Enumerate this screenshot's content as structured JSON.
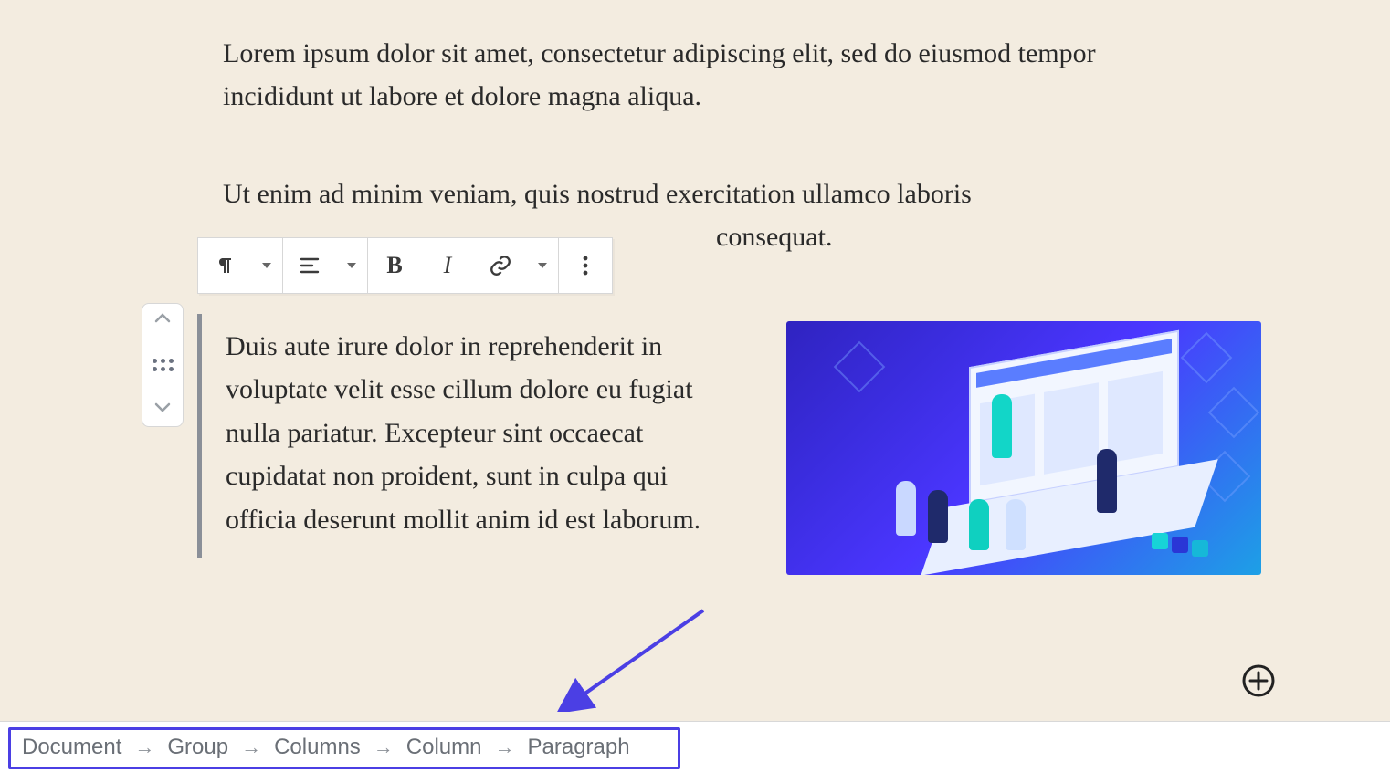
{
  "content": {
    "para1": "Lorem ipsum dolor sit amet, consectetur adipiscing elit, sed do eiusmod tempor incididunt ut labore et dolore magna aliqua.",
    "para2_line1": "Ut enim ad minim veniam, quis nostrud exercitation ullamco laboris",
    "para2_tail": "consequat.",
    "para3": "Duis aute irure dolor in reprehenderit in voluptate velit esse cillum dolore eu fugiat nulla pariatur. Excepteur sint occaecat cupidatat non proident, sunt in culpa qui officia deserunt mollit anim id est laborum."
  },
  "toolbar": {
    "bold": "B",
    "italic": "I"
  },
  "breadcrumb": [
    "Document",
    "Group",
    "Columns",
    "Column",
    "Paragraph"
  ],
  "colors": {
    "annotation": "#4b3fe4",
    "canvas_bg": "#f3ece0"
  }
}
